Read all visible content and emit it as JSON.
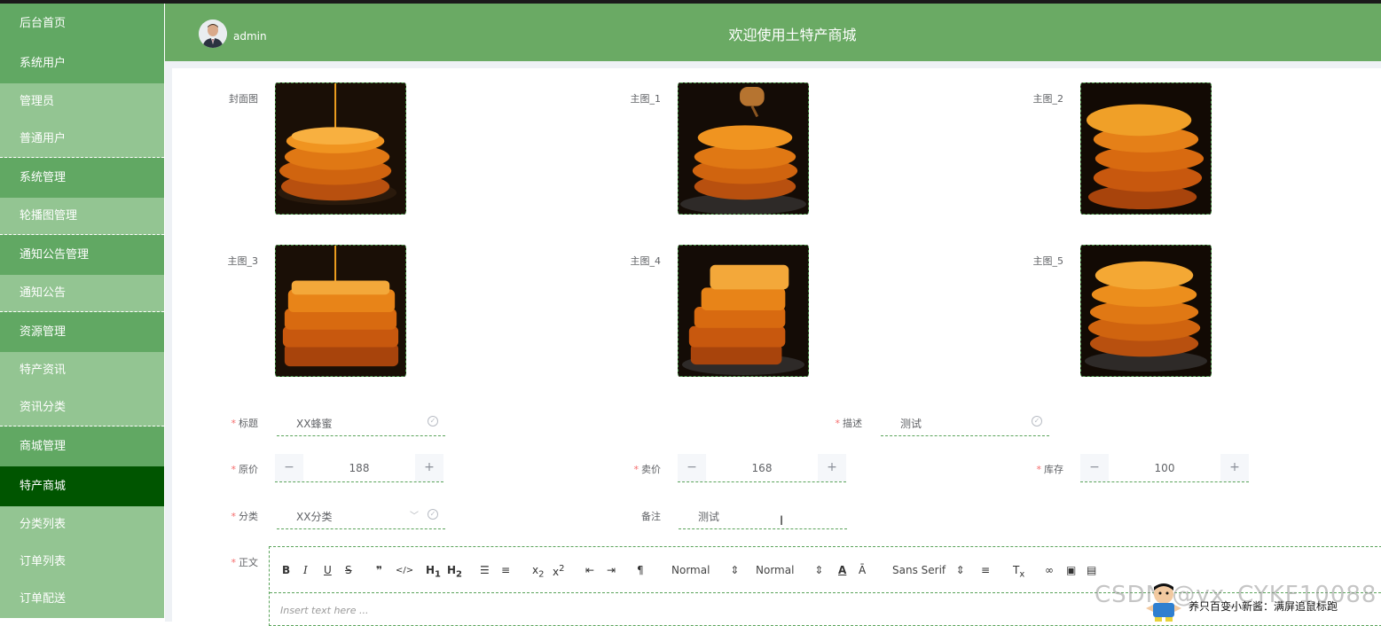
{
  "sidebar": {
    "items": [
      {
        "label": "后台首页"
      },
      {
        "label": "系统用户"
      },
      {
        "label": "管理员"
      },
      {
        "label": "普通用户"
      },
      {
        "label": "系统管理"
      },
      {
        "label": "轮播图管理"
      },
      {
        "label": "通知公告管理"
      },
      {
        "label": "通知公告"
      },
      {
        "label": "资源管理"
      },
      {
        "label": "特产资讯"
      },
      {
        "label": "资讯分类"
      },
      {
        "label": "商城管理"
      },
      {
        "label": "特产商城"
      },
      {
        "label": "分类列表"
      },
      {
        "label": "订单列表"
      },
      {
        "label": "订单配送"
      }
    ],
    "active": "特产商城"
  },
  "header": {
    "username": "admin",
    "title": "欢迎使用土特产商城"
  },
  "images": {
    "cover": "封面图",
    "main1": "主图_1",
    "main2": "主图_2",
    "main3": "主图_3",
    "main4": "主图_4",
    "main5": "主图_5"
  },
  "form": {
    "title_label": "标题",
    "title_value": "XX蜂蜜",
    "desc_label": "描述",
    "desc_value": "测试",
    "orig_price_label": "原价",
    "orig_price_value": "188",
    "sale_price_label": "卖价",
    "sale_price_value": "168",
    "stock_label": "库存",
    "stock_value": "100",
    "category_label": "分类",
    "category_value": "XX分类",
    "remark_label": "备注",
    "remark_value": "测试",
    "body_label": "正文"
  },
  "editor": {
    "header_select": "Normal",
    "size_select": "Normal",
    "font_select": "Sans Serif",
    "placeholder": "Insert text here ..."
  },
  "overlay": {
    "watermark": "CSDN @vx_CYKF10088",
    "promo": "养只百变小新酱：满屏追鼠标跑"
  },
  "colors": {
    "sidebar_group": "#61a863",
    "sidebar_sub": "#93c592",
    "sidebar_active": "#005500",
    "header": "#6aaa64",
    "required": "#f56c6c"
  }
}
